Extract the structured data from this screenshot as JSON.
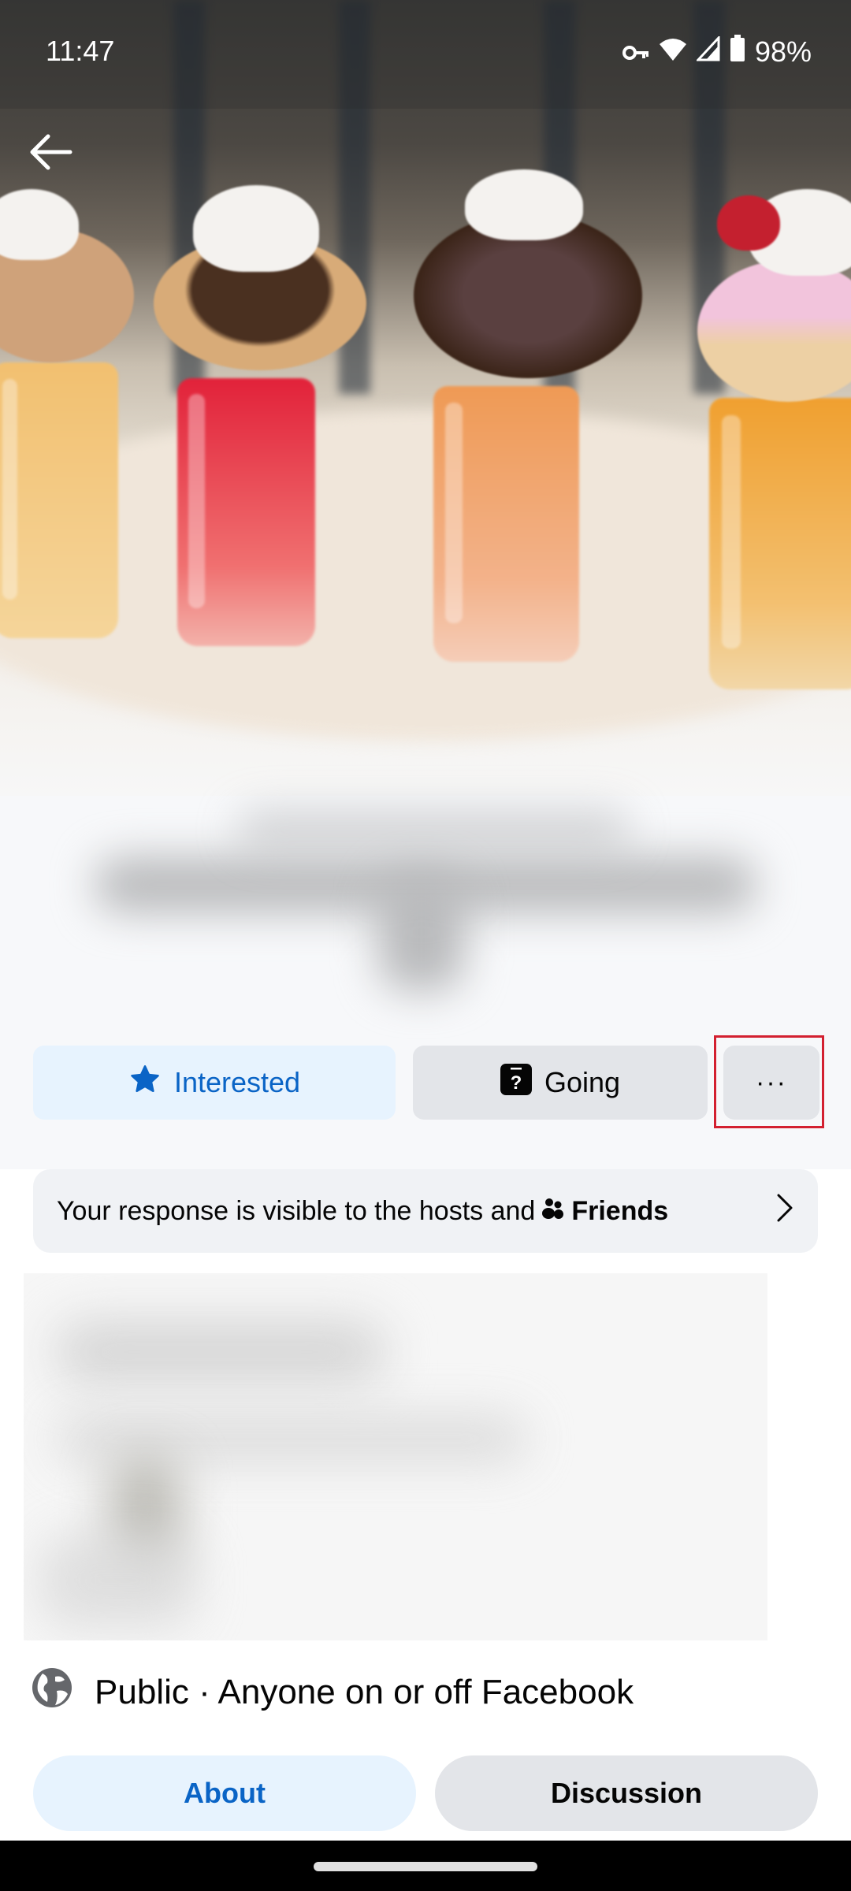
{
  "status_bar": {
    "time": "11:47",
    "battery": "98%",
    "icons": [
      "vpn-key-icon",
      "wifi-icon",
      "cellular-signal-icon",
      "battery-icon"
    ]
  },
  "header": {
    "back_icon": "arrow-left-icon"
  },
  "actions": {
    "interested_label": "Interested",
    "interested_icon": "star-icon",
    "going_label": "Going",
    "going_icon": "question-square-icon",
    "more_label": "···",
    "accent_color": "#0a64c6",
    "highlight_color": "#d32030"
  },
  "visibility_notice": {
    "text": "Your response is visible to the hosts and",
    "audience_icon": "friends-icon",
    "audience": "Friends",
    "chevron_icon": "chevron-right-icon"
  },
  "privacy": {
    "icon": "globe-icon",
    "text": "Public · Anyone on or off Facebook"
  },
  "tabs": [
    {
      "label": "About",
      "active": true
    },
    {
      "label": "Discussion",
      "active": false
    }
  ]
}
